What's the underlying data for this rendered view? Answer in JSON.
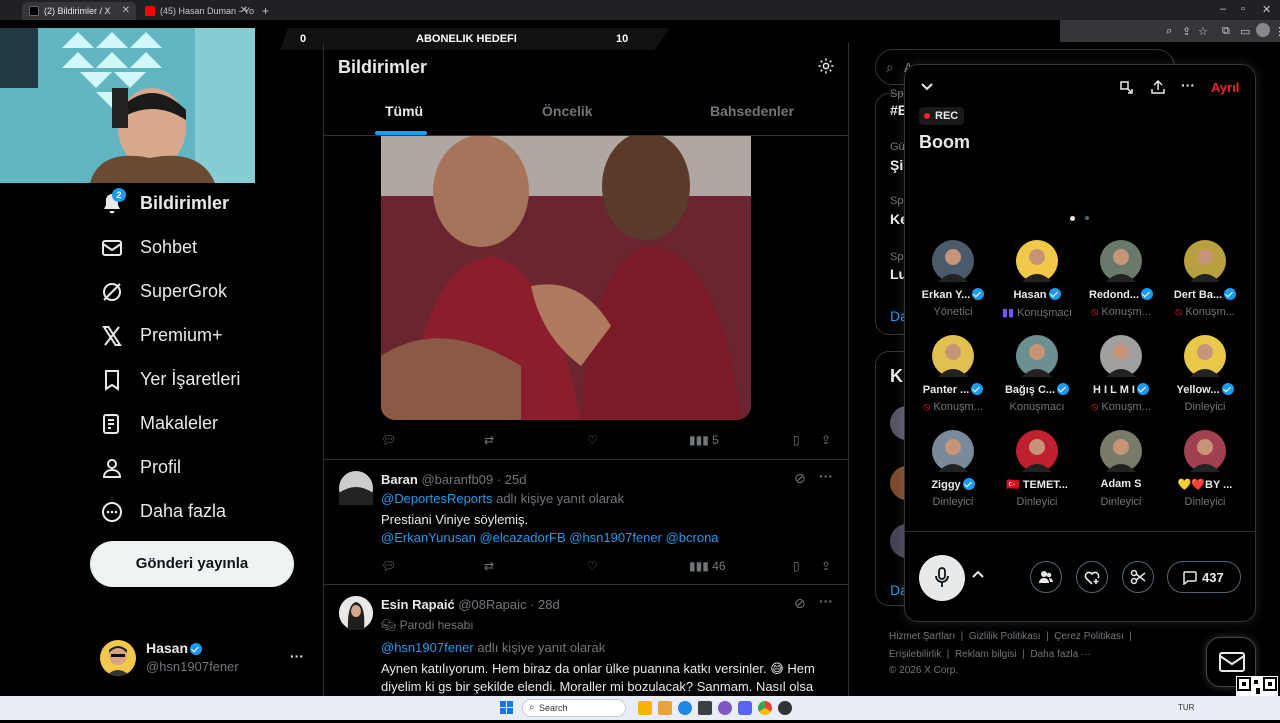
{
  "browser": {
    "tabs": [
      {
        "title": "(2) Bildirimler / X",
        "active": true
      },
      {
        "title": "(45) Hasan Duman - YouTube",
        "active": false
      }
    ],
    "new_tab": "+"
  },
  "overlay": {
    "banner_left": "0",
    "banner_title": "ABONELIK HEDEFI",
    "banner_right": "10"
  },
  "sidebar": {
    "notif_badge": "2",
    "items": [
      {
        "label": "Bildirimler",
        "icon": "bell-icon",
        "active": true
      },
      {
        "label": "Sohbet",
        "icon": "mail-icon"
      },
      {
        "label": "SuperGrok",
        "icon": "grok-icon"
      },
      {
        "label": "Premium+",
        "icon": "x-logo-icon"
      },
      {
        "label": "Yer İşaretleri",
        "icon": "bookmark-icon"
      },
      {
        "label": "Makaleler",
        "icon": "article-icon"
      },
      {
        "label": "Profil",
        "icon": "person-icon"
      },
      {
        "label": "Daha fazla",
        "icon": "more-circle-icon"
      }
    ],
    "post_button": "Gönderi yayınla",
    "account": {
      "name": "Hasan",
      "handle": "@hsn1907fener",
      "more": "···"
    }
  },
  "main": {
    "title": "Bildirimler",
    "tabs": [
      "Tümü",
      "Öncelik",
      "Bahsedenler"
    ],
    "first_tweet": {
      "views": "5"
    },
    "tweets": [
      {
        "name": "Baran",
        "handle": "@baranfb09",
        "time": "· 25d",
        "reply_to": "@DeportesReports",
        "reply_suffix": "adlı kişiye yanıt olarak",
        "text": "Prestiani Viniye söylemiş.",
        "mentions": "@ErkanYurusan @elcazadorFB @hsn1907fener @bcrona",
        "views": "46"
      },
      {
        "name": "Esin Rapaić",
        "handle": "@08Rapaic",
        "time": "· 28d",
        "parody": "Parodi hesabı",
        "reply_to": "@hsn1907fener",
        "reply_suffix": "adlı kişiye yanıt olarak",
        "text_line1": "Aynen katılıyorum. Hem biraz da onlar ülke puanına katkı versinler. 😅 Hem",
        "text_line2": "diyelim ki gs bir şekilde elendi. Moraller mi bozulacak? Sanmam. Nasıl olsa"
      }
    ]
  },
  "right": {
    "search_placeholder": "A",
    "trends": [
      {
        "label": "Spo",
        "title": "#E"
      },
      {
        "label": "Gün",
        "title": "Şik"
      },
      {
        "label": "Spo",
        "title": "Ke"
      },
      {
        "label": "Spo",
        "title": "Luc"
      }
    ],
    "show_more": "Da",
    "who_to_follow": "Ki",
    "show_more2": "Da",
    "footer": {
      "links1": [
        "Hizmet Şartları",
        "Gizlilik Politikası",
        "Çerez Politikası"
      ],
      "links2": [
        "Erişilebilirlik",
        "Reklam bilgisi",
        "Daha fazla ···"
      ],
      "copyright": "© 2026 X Corp."
    }
  },
  "space": {
    "leave_label": "Ayrıl",
    "rec_label": "REC",
    "title": "Boom",
    "listeners_count": "437",
    "people": [
      {
        "name": "Erkan Y...",
        "role": "Yönetici",
        "verified": true,
        "role_icon": ""
      },
      {
        "name": "Hasan",
        "role": "Konuşmacı",
        "verified": true,
        "role_icon": "speaking"
      },
      {
        "name": "Redond...",
        "role": "Konuşm...",
        "verified": true,
        "role_icon": "muted"
      },
      {
        "name": "Dert Ba...",
        "role": "Konuşm...",
        "verified": true,
        "role_icon": "muted"
      },
      {
        "name": "Panter ...",
        "role": "Konuşm...",
        "verified": true,
        "role_icon": "muted"
      },
      {
        "name": "Bağış C...",
        "role": "Konuşmacı",
        "verified": true,
        "role_icon": ""
      },
      {
        "name": "H I L M I",
        "role": "Konuşm...",
        "verified": true,
        "role_icon": "muted"
      },
      {
        "name": "Yellow...",
        "role": "Dinleyici",
        "verified": true,
        "role_icon": ""
      },
      {
        "name": "Ziggy",
        "role": "Dinleyici",
        "verified": true,
        "role_icon": ""
      },
      {
        "name": "🇹🇷 TEMET...",
        "role": "Dinleyici",
        "verified": false,
        "role_icon": ""
      },
      {
        "name": "Adam S",
        "role": "Dinleyici",
        "verified": false,
        "role_icon": ""
      },
      {
        "name": "💛❤️BY ...",
        "role": "Dinleyici",
        "verified": false,
        "role_icon": ""
      }
    ]
  },
  "taskbar": {
    "search_label": "Search",
    "lang": "TUR"
  },
  "colors": {
    "accent": "#1d9bf0",
    "leave": "#f4212e",
    "speaking": "#7856ff",
    "muted_red": "#f4212e"
  }
}
